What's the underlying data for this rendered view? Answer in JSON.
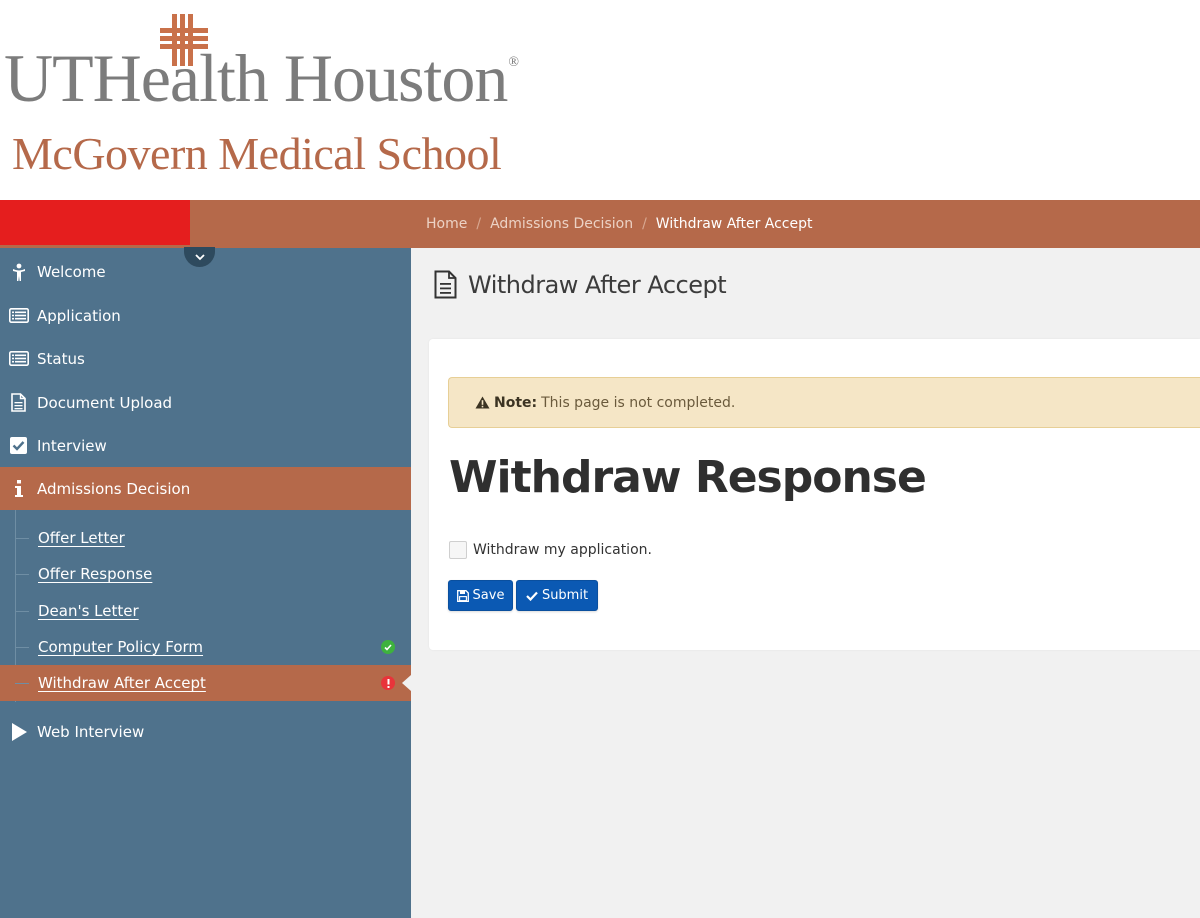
{
  "brand": {
    "primary": "UTHealth Houston",
    "primary_mark": "®",
    "secondary": "McGovern Medical School",
    "accent_color": "#b5694a",
    "logo_gray": "#7c7c7c"
  },
  "breadcrumb": {
    "items": [
      "Home",
      "Admissions Decision",
      "Withdraw After Accept"
    ],
    "separator": "/"
  },
  "sidebar": {
    "bg_color": "#4f728c",
    "items": [
      {
        "label": "Welcome",
        "icon": "person-icon"
      },
      {
        "label": "Application",
        "icon": "list-icon"
      },
      {
        "label": "Status",
        "icon": "list-icon"
      },
      {
        "label": "Document Upload",
        "icon": "document-icon"
      },
      {
        "label": "Interview",
        "icon": "checkbox-icon"
      },
      {
        "label": "Admissions Decision",
        "icon": "info-icon",
        "active": true
      },
      {
        "label": "Web Interview",
        "icon": "play-icon"
      }
    ],
    "subitems": [
      {
        "label": "Offer Letter"
      },
      {
        "label": "Offer Response"
      },
      {
        "label": "Dean's Letter"
      },
      {
        "label": "Computer Policy Form",
        "status": "complete",
        "status_color": "#3eb23e"
      },
      {
        "label": "Withdraw After Accept",
        "status": "incomplete",
        "status_color": "#e8343a",
        "active": true
      }
    ]
  },
  "main": {
    "page_title": "Withdraw After Accept",
    "alert": {
      "label": "Note:",
      "message": "This page is not completed."
    },
    "section_title": "Withdraw Response",
    "checkbox_label": "Withdraw my application.",
    "checkbox_checked": false,
    "buttons": {
      "save": "Save",
      "submit": "Submit",
      "color": "#0b59b3"
    }
  }
}
